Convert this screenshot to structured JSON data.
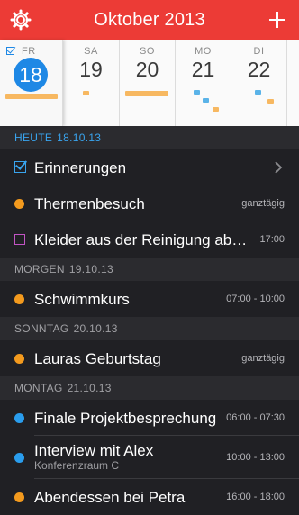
{
  "header": {
    "title": "Oktober 2013",
    "settings_icon": "gear-icon",
    "add_icon": "plus-icon",
    "color": "#ec3b36"
  },
  "week": {
    "days": [
      {
        "name": "FR",
        "num": "18",
        "selected": true
      },
      {
        "name": "SA",
        "num": "19"
      },
      {
        "name": "SO",
        "num": "20"
      },
      {
        "name": "MO",
        "num": "21"
      },
      {
        "name": "DI",
        "num": "22"
      }
    ]
  },
  "sections": [
    {
      "label": "HEUTE",
      "date": "18.10.13",
      "rows": [
        {
          "title": "Erinnerungen",
          "kind": "reminders",
          "chevron": "chevron-right-icon"
        },
        {
          "title": "Thermenbesuch",
          "kind": "event",
          "color": "#f39a1e",
          "time": "ganztägig"
        },
        {
          "title": "Kleider aus der Reinigung abh…",
          "kind": "task",
          "color": "#c254c4",
          "time": "17:00"
        }
      ]
    },
    {
      "label": "MORGEN",
      "date": "19.10.13",
      "rows": [
        {
          "title": "Schwimmkurs",
          "kind": "event",
          "color": "#f39a1e",
          "time": "07:00 - 10:00"
        }
      ]
    },
    {
      "label": "SONNTAG",
      "date": "20.10.13",
      "rows": [
        {
          "title": "Lauras Geburtstag",
          "kind": "event",
          "color": "#f39a1e",
          "time": "ganztägig"
        }
      ]
    },
    {
      "label": "MONTAG",
      "date": "21.10.13",
      "rows": [
        {
          "title": "Finale Projektbesprechung",
          "kind": "event",
          "color": "#2a9ded",
          "time": "06:00 - 07:30"
        },
        {
          "title": "Interview mit Alex",
          "subtitle": "Konferenzraum C",
          "kind": "event",
          "color": "#2a9ded",
          "time": "10:00 - 13:00"
        },
        {
          "title": "Abendessen bei Petra",
          "kind": "event",
          "color": "#f39a1e",
          "time": "16:00 - 18:00"
        }
      ]
    }
  ]
}
